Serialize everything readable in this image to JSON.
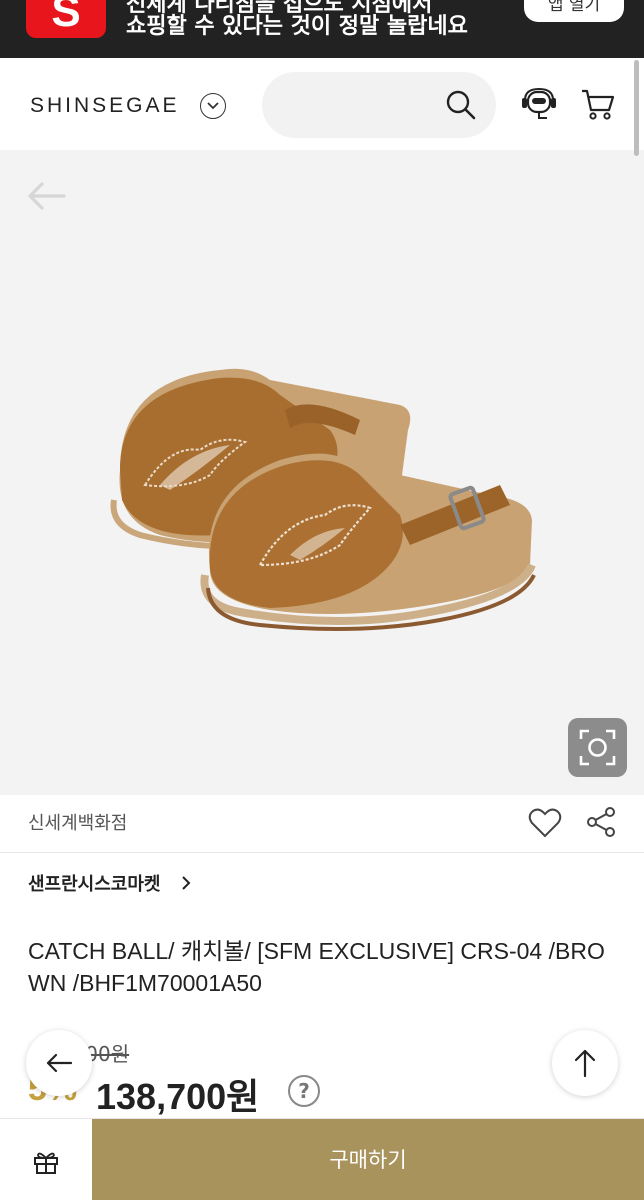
{
  "promo": {
    "logo_letter": "S",
    "line1": "전세계 다리침을 접으도 시점에서",
    "line2": "쇼핑할 수 있다는 것이 정말 놀랍네요",
    "button_label": "앱 열기"
  },
  "header": {
    "brand": "SHINSEGAE",
    "search_placeholder": ""
  },
  "icons": {
    "search": "search-icon",
    "chatbot": "chatbot-icon",
    "cart": "cart-icon",
    "back": "arrow-left-icon",
    "lens": "camera-lens-icon",
    "heart": "heart-icon",
    "share": "share-icon",
    "gift": "gift-icon",
    "top": "arrow-up-icon"
  },
  "product": {
    "store": "신세계백화점",
    "brand_link": "샌프란시스코마켓",
    "title": "CATCH BALL/ 캐치볼/ [SFM EXCLUSIVE] CRS-04 /BROWN /BHF1M70001A50",
    "original_price": "146,000원",
    "discount": "5%",
    "sale_price": "138,700원",
    "help": "?"
  },
  "bottom": {
    "buy_label": "구매하기"
  },
  "colors": {
    "accent_gold": "#a8935c",
    "discount_gold": "#c5a23f",
    "promo_red": "#e8161c"
  }
}
